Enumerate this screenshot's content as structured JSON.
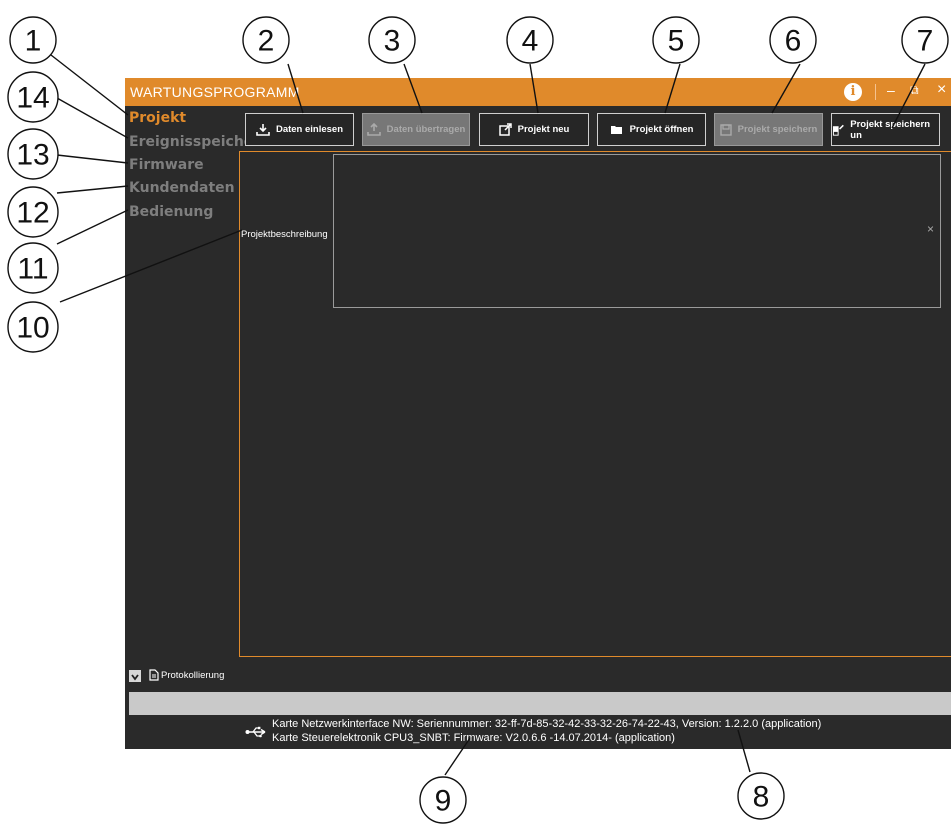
{
  "window": {
    "title": "WARTUNGSPROGRAMM",
    "info_symbol": "i",
    "min_symbol": "–",
    "max_symbol": "⧉",
    "close_symbol": "×"
  },
  "nav": {
    "items": [
      {
        "label": "Projekt",
        "active": true
      },
      {
        "label": "Ereignisspeicher",
        "active": false
      },
      {
        "label": "Firmware",
        "active": false
      },
      {
        "label": "Kundendaten",
        "active": false
      },
      {
        "label": "Bedienung",
        "active": false
      }
    ]
  },
  "toolbar": {
    "buttons": [
      {
        "label": "Daten einlesen",
        "icon": "download-icon",
        "enabled": true
      },
      {
        "label": "Daten übertragen",
        "icon": "upload-icon",
        "enabled": false
      },
      {
        "label": "Projekt neu",
        "icon": "new-document-icon",
        "enabled": true
      },
      {
        "label": "Projekt öffnen",
        "icon": "open-folder-icon",
        "enabled": true
      },
      {
        "label": "Projekt speichern",
        "icon": "save-icon",
        "enabled": false
      },
      {
        "label": "Projekt speichern un",
        "icon": "save-as-icon",
        "enabled": true
      }
    ]
  },
  "project": {
    "description_label": "Projektbeschreibung",
    "description_value": "",
    "clear_symbol": "×"
  },
  "log": {
    "toggle_symbol": "⌄",
    "label": "Protokollierung"
  },
  "status": {
    "lines": [
      "Karte Netzwerkinterface NW: Seriennummer: 32-ff-7d-85-32-42-33-32-26-74-22-43, Version: 1.2.2.0 (application)",
      "Karte Steuerelektronik CPU3_SNBT: Firmware: V2.0.6.6 -14.07.2014-  (application)"
    ]
  },
  "callouts": [
    "1",
    "2",
    "3",
    "4",
    "5",
    "6",
    "7",
    "8",
    "9",
    "10",
    "11",
    "12",
    "13",
    "14"
  ],
  "colors": {
    "accent": "#e08a2b",
    "background": "#2a2a2a",
    "text": "#ffffff",
    "muted": "#7e7e7e"
  }
}
